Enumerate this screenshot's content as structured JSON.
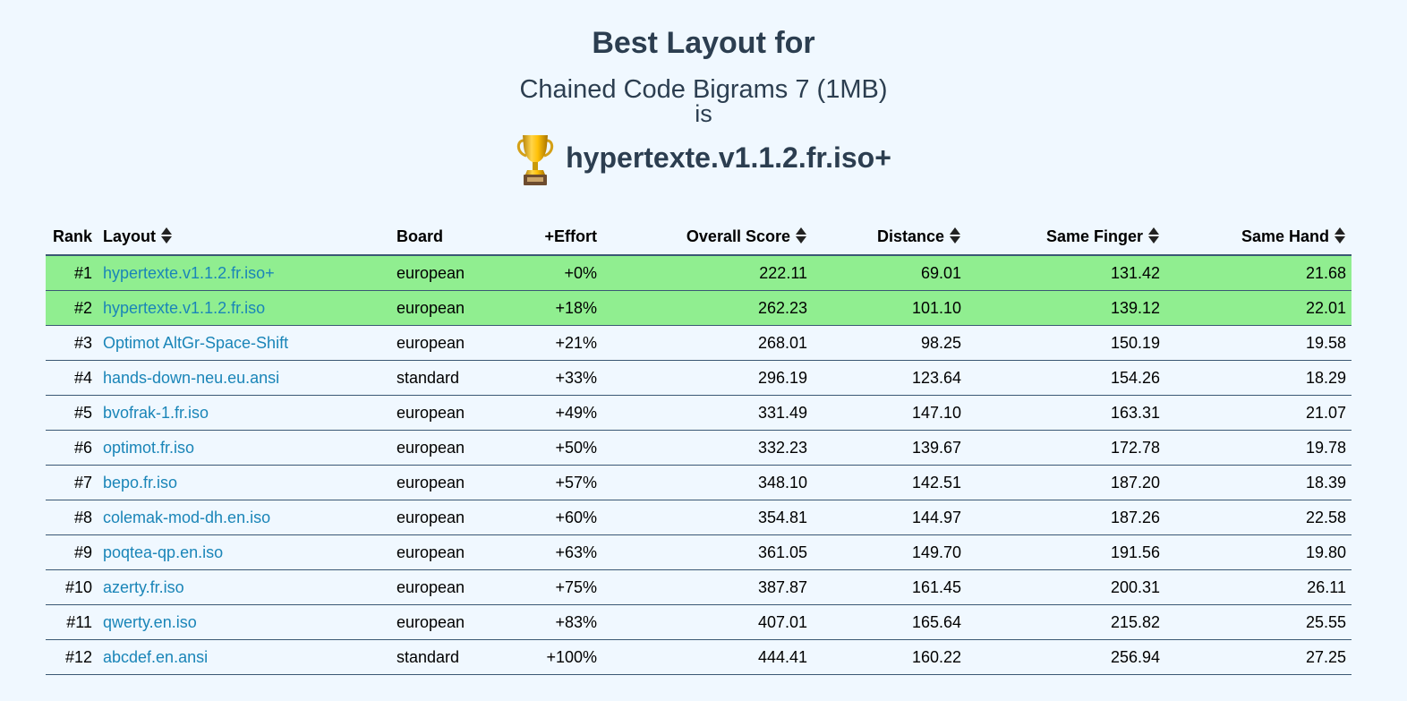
{
  "header": {
    "title": "Best Layout for",
    "corpus": "Chained Code Bigrams 7 (1MB)",
    "is": "is",
    "winner": "hypertexte.v1.1.2.fr.iso+",
    "winner_icon": "trophy-icon"
  },
  "colors": {
    "background": "#f0f8ff",
    "highlight_row": "#90ee90",
    "link": "#1a85b8",
    "heading": "#2c3e50"
  },
  "table": {
    "columns": [
      {
        "label": "Rank",
        "sortable": false
      },
      {
        "label": "Layout",
        "sortable": true
      },
      {
        "label": "Board",
        "sortable": false
      },
      {
        "label": "+Effort",
        "sortable": false
      },
      {
        "label": "Overall Score",
        "sortable": true
      },
      {
        "label": "Distance",
        "sortable": true
      },
      {
        "label": "Same Finger",
        "sortable": true
      },
      {
        "label": "Same Hand",
        "sortable": true
      }
    ],
    "rows": [
      {
        "rank": "#1",
        "layout": "hypertexte.v1.1.2.fr.iso+",
        "board": "european",
        "effort": "+0%",
        "score": "222.11",
        "distance": "69.01",
        "same_finger": "131.42",
        "same_hand": "21.68",
        "highlight": true
      },
      {
        "rank": "#2",
        "layout": "hypertexte.v1.1.2.fr.iso",
        "board": "european",
        "effort": "+18%",
        "score": "262.23",
        "distance": "101.10",
        "same_finger": "139.12",
        "same_hand": "22.01",
        "highlight": true
      },
      {
        "rank": "#3",
        "layout": "Optimot AltGr-Space-Shift",
        "board": "european",
        "effort": "+21%",
        "score": "268.01",
        "distance": "98.25",
        "same_finger": "150.19",
        "same_hand": "19.58",
        "highlight": false
      },
      {
        "rank": "#4",
        "layout": "hands-down-neu.eu.ansi",
        "board": "standard",
        "effort": "+33%",
        "score": "296.19",
        "distance": "123.64",
        "same_finger": "154.26",
        "same_hand": "18.29",
        "highlight": false
      },
      {
        "rank": "#5",
        "layout": "bvofrak-1.fr.iso",
        "board": "european",
        "effort": "+49%",
        "score": "331.49",
        "distance": "147.10",
        "same_finger": "163.31",
        "same_hand": "21.07",
        "highlight": false
      },
      {
        "rank": "#6",
        "layout": "optimot.fr.iso",
        "board": "european",
        "effort": "+50%",
        "score": "332.23",
        "distance": "139.67",
        "same_finger": "172.78",
        "same_hand": "19.78",
        "highlight": false
      },
      {
        "rank": "#7",
        "layout": "bepo.fr.iso",
        "board": "european",
        "effort": "+57%",
        "score": "348.10",
        "distance": "142.51",
        "same_finger": "187.20",
        "same_hand": "18.39",
        "highlight": false
      },
      {
        "rank": "#8",
        "layout": "colemak-mod-dh.en.iso",
        "board": "european",
        "effort": "+60%",
        "score": "354.81",
        "distance": "144.97",
        "same_finger": "187.26",
        "same_hand": "22.58",
        "highlight": false
      },
      {
        "rank": "#9",
        "layout": "poqtea-qp.en.iso",
        "board": "european",
        "effort": "+63%",
        "score": "361.05",
        "distance": "149.70",
        "same_finger": "191.56",
        "same_hand": "19.80",
        "highlight": false
      },
      {
        "rank": "#10",
        "layout": "azerty.fr.iso",
        "board": "european",
        "effort": "+75%",
        "score": "387.87",
        "distance": "161.45",
        "same_finger": "200.31",
        "same_hand": "26.11",
        "highlight": false
      },
      {
        "rank": "#11",
        "layout": "qwerty.en.iso",
        "board": "european",
        "effort": "+83%",
        "score": "407.01",
        "distance": "165.64",
        "same_finger": "215.82",
        "same_hand": "25.55",
        "highlight": false
      },
      {
        "rank": "#12",
        "layout": "abcdef.en.ansi",
        "board": "standard",
        "effort": "+100%",
        "score": "444.41",
        "distance": "160.22",
        "same_finger": "256.94",
        "same_hand": "27.25",
        "highlight": false
      }
    ]
  }
}
